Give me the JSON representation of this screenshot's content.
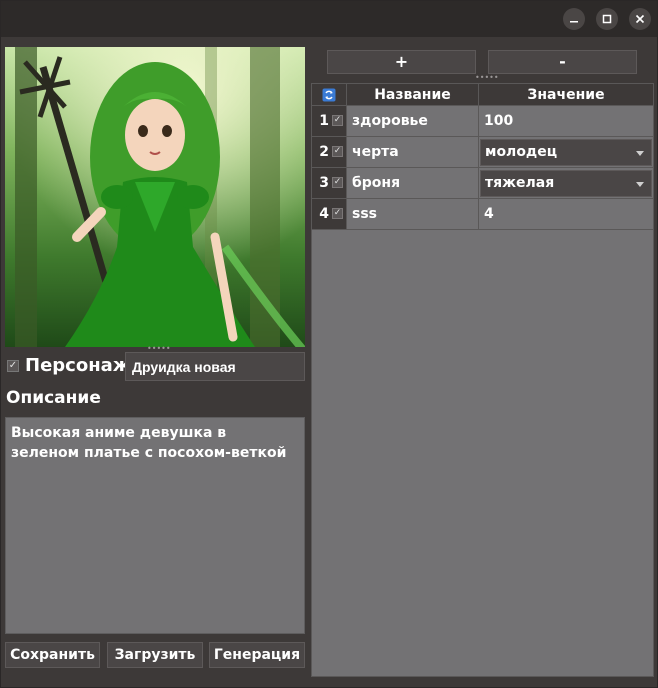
{
  "window": {
    "controls": [
      "minimize-icon",
      "maximize-icon",
      "close-icon"
    ]
  },
  "character": {
    "checked": true,
    "label": "Персонаж",
    "name_value": "Друидка новая",
    "description_label": "Описание",
    "description_text": "Высокая аниме девушка в зеленом платье с посохом-веткой"
  },
  "buttons": {
    "save": "Сохранить",
    "load": "Загрузить",
    "generate": "Генерация",
    "add": "+",
    "remove": "-"
  },
  "table": {
    "header_icon": "refresh-icon",
    "columns": [
      "Название",
      "Значение"
    ],
    "rows": [
      {
        "num": "1",
        "checked": true,
        "name": "здоровье",
        "value": "100",
        "type": "text"
      },
      {
        "num": "2",
        "checked": true,
        "name": "черта",
        "value": "молодец",
        "type": "combo"
      },
      {
        "num": "3",
        "checked": true,
        "name": "броня",
        "value": "тяжелая",
        "type": "combo"
      },
      {
        "num": "4",
        "checked": true,
        "name": "sss",
        "value": "4",
        "type": "text"
      }
    ]
  },
  "colors": {
    "window_bg": "#3d3938",
    "panel_bg": "#737274",
    "portrait_green": "#2f7d25"
  }
}
